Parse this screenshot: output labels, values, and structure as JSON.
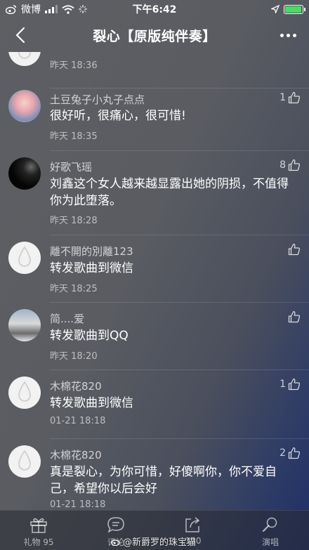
{
  "status_bar": {
    "carrier": "微博",
    "time": "下午6:42",
    "battery_color": "#4cd964"
  },
  "nav": {
    "title": "裂心【原版纯伴奏】"
  },
  "comments": [
    {
      "user": "",
      "text": "",
      "time": "昨天 18:36",
      "likes": ""
    },
    {
      "user": "土豆兔子小丸子点点",
      "text": "很好听，很痛心，很可惜!",
      "time": "昨天 18:35",
      "likes": "1"
    },
    {
      "user": "好歌飞瑶",
      "text": "刘鑫这个女人越来越显露出她的阴损，不值得你为此堕落。",
      "time": "昨天 18:28",
      "likes": "8"
    },
    {
      "user": "離不開的別離123",
      "text": "转发歌曲到微信",
      "time": "昨天 18:25",
      "likes": ""
    },
    {
      "user": "简....爱",
      "text": "转发歌曲到QQ",
      "time": "昨天 18:20",
      "likes": ""
    },
    {
      "user": "木棉花820",
      "text": "转发歌曲到微信",
      "time": "01-21 18:18",
      "likes": "1"
    },
    {
      "user": "木棉花820",
      "text": "真是裂心，为你可惜，好傻啊你，你不爱自己，希望你以后会好",
      "time": "01-21 18:18",
      "likes": "2"
    }
  ],
  "tabs": [
    {
      "label": "礼物 95",
      "icon": "gift-icon"
    },
    {
      "label": "评论",
      "icon": "comment-icon"
    },
    {
      "label": "190",
      "icon": "share-icon"
    },
    {
      "label": "演唱",
      "icon": "microphone-icon"
    }
  ],
  "watermark": "@新爵罗的珠宝猫"
}
